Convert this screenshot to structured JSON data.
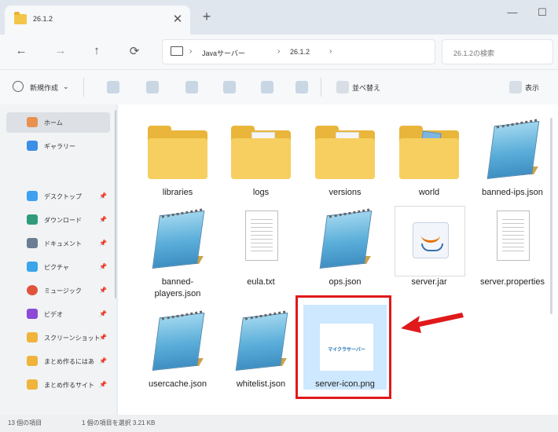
{
  "tab": {
    "title": "26.1.2",
    "close": "✕",
    "new_tab": "+"
  },
  "window": {
    "minimize": "—",
    "maximize": "☐"
  },
  "nav": {
    "back": "←",
    "forward": "→",
    "up": "↑",
    "refresh": "⟳",
    "more": "›"
  },
  "address": {
    "crumbs": [
      "Javaサーバー",
      "26.1.2"
    ],
    "sep": "›"
  },
  "search": {
    "placeholder": "26.1.2の検索"
  },
  "toolbar": {
    "new_label": "新規作成",
    "new_caret": "⌄",
    "sort_label": "並べ替え",
    "view_label": "表示"
  },
  "sidebar": {
    "items": [
      {
        "label": "ホーム",
        "icon": "home-icon",
        "color": "#e8914f"
      },
      {
        "label": "ギャラリー",
        "icon": "gallery-icon",
        "color": "#3b8fe6"
      },
      {
        "label": "デスクトップ",
        "icon": "desktop-icon",
        "color": "#3ea0f0",
        "pin": "📌"
      },
      {
        "label": "ダウンロード",
        "icon": "download-icon",
        "color": "#2f9b7b",
        "pin": "📌"
      },
      {
        "label": "ドキュメント",
        "icon": "documents-icon",
        "color": "#6a7d91",
        "pin": "📌"
      },
      {
        "label": "ピクチャ",
        "icon": "pictures-icon",
        "color": "#3aa5e8",
        "pin": "📌"
      },
      {
        "label": "ミュージック",
        "icon": "music-icon",
        "color": "#e0533b",
        "pin": "📌"
      },
      {
        "label": "ビデオ",
        "icon": "videos-icon",
        "color": "#8c4ad6",
        "pin": "📌"
      },
      {
        "label": "スクリーンショット",
        "icon": "folder-icon",
        "color": "#f0b43c",
        "pin": "📌"
      },
      {
        "label": "まとめ作るにはあ",
        "icon": "folder-icon",
        "color": "#f0b43c",
        "pin": "📌"
      },
      {
        "label": "まとめ作るサイト",
        "icon": "folder-icon",
        "color": "#f0b43c",
        "pin": "📌"
      }
    ]
  },
  "files": [
    {
      "name": "libraries",
      "type": "folder"
    },
    {
      "name": "logs",
      "type": "folder-doc"
    },
    {
      "name": "versions",
      "type": "folder-doc"
    },
    {
      "name": "world",
      "type": "folder-image"
    },
    {
      "name": "banned-ips.json",
      "type": "notepad"
    },
    {
      "name": "banned-players.json",
      "type": "notepad"
    },
    {
      "name": "eula.txt",
      "type": "text"
    },
    {
      "name": "ops.json",
      "type": "notepad"
    },
    {
      "name": "server.jar",
      "type": "jar"
    },
    {
      "name": "server.properties",
      "type": "text"
    },
    {
      "name": "usercache.json",
      "type": "notepad"
    },
    {
      "name": "whitelist.json",
      "type": "notepad"
    },
    {
      "name": "server-icon.png",
      "type": "image",
      "selected": true
    }
  ],
  "png_thumb_text": "マイクラサーバー",
  "status": {
    "count": "13 個の項目",
    "selected": "1 個の項目を選択 3.21 KB"
  },
  "colors": {
    "highlight": "#e0191a",
    "selection": "#cde8ff"
  }
}
